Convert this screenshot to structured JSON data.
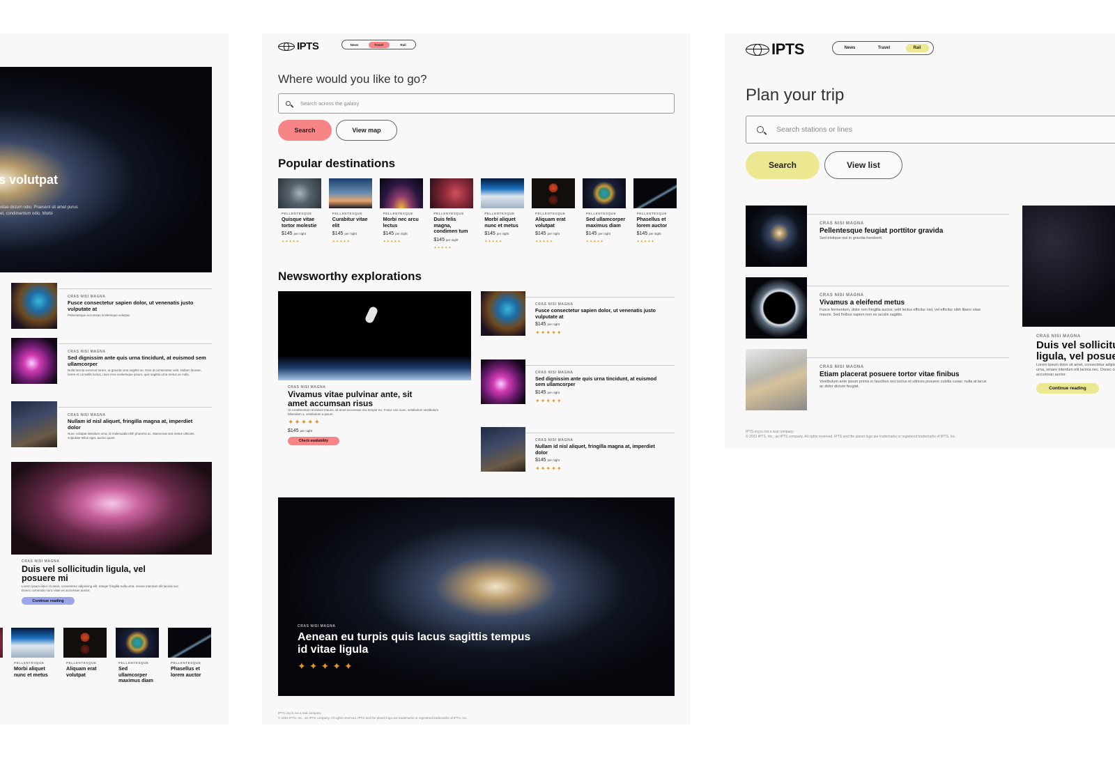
{
  "brand": {
    "name": "IPTS"
  },
  "left_panel": {
    "hero": {
      "title_fragment": "s volutpat",
      "body": "vitae dictum odio. Praesent sit amet purus et, condimentum odio. Morbi"
    },
    "news": [
      {
        "kicker": "CRAS NISI MAGNA",
        "title": "Fusce consectetur sapien dolor, ut venenatis justo vulputate at",
        "body": "Pellentesque accumsan scelerisque volutpat."
      },
      {
        "kicker": "CRAS NISI MAGNA",
        "title": "Sed dignissim ante quis urna tincidunt, at euismod sem ullamcorper",
        "body": "Nulla lacinia euismod lorem, at gravida urna sagittis ac. Duis at consectetur velit. Nullam laoreet, lorem et convallis luctus, risus eros scelerisque ipsum, quis sagittis urna metus ac nulla."
      },
      {
        "kicker": "CRAS NISI MAGNA",
        "title": "Nullam id nisl aliquet, fringilla magna at, imperdiet dolor",
        "body": "Nunc volutpat interdum urna, id malesuada nibh pharetra ac. Maecenas sed metus ultricies, vulputate tellus eget, auctor quam."
      }
    ],
    "feature": {
      "kicker": "CRAS NISI MAGNA",
      "title": "Duis vel sollicitudin ligula, vel posuere mi",
      "body": "Lorem ipsum dolor sit amet, consectetur adipiscing elit. Integer fringilla nulla urna, ornare interdum elit lacinia nec. Donec commodo nunc vitae ex accumsan auctor.",
      "button": "Continue reading",
      "accent": "#9aa6e8"
    },
    "destinations": [
      {
        "kicker": "PELLENTESQUE",
        "title": "Morbi aliquet nunc et metus"
      },
      {
        "kicker": "PELLENTESQUE",
        "title": "Aliquam erat volutpat"
      },
      {
        "kicker": "PELLENTESQUE",
        "title": "Sed ullamcorper maximus diam"
      },
      {
        "kicker": "PELLENTESQUE",
        "title": "Phasellus et lorem auctor"
      }
    ]
  },
  "mid_panel": {
    "nav": {
      "items": [
        "News",
        "Travel",
        "Rail"
      ],
      "active": "Travel"
    },
    "accent": "#f78587",
    "heading": "Where would you like to go?",
    "search": {
      "placeholder": "Search across the galaxy"
    },
    "buttons": {
      "primary": "Search",
      "secondary": "View map"
    },
    "popular": {
      "title": "Popular destinations",
      "items": [
        {
          "kicker": "PELLENTESQUE",
          "title": "Quisque vitae tortor molestie",
          "price": "$145",
          "unit": "per night",
          "rating": 5
        },
        {
          "kicker": "PELLENTESQUE",
          "title": "Curabitur vitae elit",
          "price": "$145",
          "unit": "per night",
          "rating": 5
        },
        {
          "kicker": "PELLENTESQUE",
          "title": "Morbi nec arcu lectus",
          "price": "$145",
          "unit": "per night",
          "rating": 5
        },
        {
          "kicker": "PELLENTESQUE",
          "title": "Duis felis magna, condimen tum",
          "price": "$145",
          "unit": "per night",
          "rating": 5
        },
        {
          "kicker": "PELLENTESQUE",
          "title": "Morbi aliquet nunc et metus",
          "price": "$145",
          "unit": "per night",
          "rating": 5
        },
        {
          "kicker": "PELLENTESQUE",
          "title": "Aliquam erat volutpat",
          "price": "$145",
          "unit": "per night",
          "rating": 5
        },
        {
          "kicker": "PELLENTESQUE",
          "title": "Sed ullamcorper maximus diam",
          "price": "$145",
          "unit": "per night",
          "rating": 5
        },
        {
          "kicker": "PELLENTESQUE",
          "title": "Phasellus et lorem auctor",
          "price": "$145",
          "unit": "per night",
          "rating": 5
        }
      ]
    },
    "newsworthy": {
      "title": "Newsworthy explorations",
      "feature": {
        "kicker": "CRAS NISI MAGNA",
        "title": "Vivamus vitae pulvinar ante, sit amet accumsan risus",
        "body": "Ut condimentum tincidunt mauris, sit amet accumsan nisi tempor eu. Fusce orci nunc, vestibulum vestibulum bibendum a, vestibulum a ipsum.",
        "rating": 5,
        "price": "$145",
        "unit": "per night",
        "button": "Check availability"
      },
      "items": [
        {
          "kicker": "CRAS NISI MAGNA",
          "title": "Fusce consectetur sapien dolor, ut venenatis justo vulputate at",
          "price": "$145",
          "unit": "per night",
          "rating": 5
        },
        {
          "kicker": "CRAS NISI MAGNA",
          "title": "Sed dignissim ante quis urna tincidunt, at euismod sem ullamcorper",
          "price": "$145",
          "unit": "per night",
          "rating": 5
        },
        {
          "kicker": "CRAS NISI MAGNA",
          "title": "Nullam id nisl aliquet, fringilla magna at, imperdiet dolor",
          "price": "$145",
          "unit": "per night",
          "rating": 5
        }
      ]
    },
    "hero": {
      "kicker": "CRAS NISI MAGNA",
      "title": "Aenean eu turpis quis lacus sagittis tempus id vitae ligula",
      "rating": 5
    },
    "footer": {
      "line1": "IPTS.org is not a real company.",
      "line2": "© 2023 IPTS, Inc., an IPTS company. All rights reserved. IPTS and the planet logo are trademarks or registered trademarks of IPTS, Inc."
    }
  },
  "right_panel": {
    "nav": {
      "items": [
        "News",
        "Travel",
        "Rail"
      ],
      "active": "Rail"
    },
    "accent": "#ece892",
    "heading": "Plan your trip",
    "search": {
      "placeholder": "Search stations or lines"
    },
    "buttons": {
      "primary": "Search",
      "secondary": "View list"
    },
    "news": [
      {
        "kicker": "CRAS NISI MAGNA",
        "title": "Pellentesque feugiat porttitor gravida",
        "body": "Sed tristique nisl in gravida hendrerit."
      },
      {
        "kicker": "CRAS NISI MAGNA",
        "title": "Vivamus a eleifend metus",
        "body": "Fusce fermentum, dolor non fringilla auctor, velit lectus efficitur nisl, vel efficitur nibh libero vitae mauris. Sed finibus sapien non ex iaculis sagittis."
      },
      {
        "kicker": "CRAS NISI MAGNA",
        "title": "Etiam placerat posuere tortor vitae finibus",
        "body": "Vestibulum ante ipsum primis in faucibus orci luctus et ultrices posuere cubilia curae; nulla at lacus ac dolor dictum feugiat."
      }
    ],
    "feature": {
      "kicker": "CRAS NISI MAGNA",
      "title": "Duis vel sollicitudin ligula, vel posuere mi",
      "body": "Lorem ipsum dolor sit amet, consectetur adipiscing elit. Integer fringilla nulla urna, ornare interdum elit lacinia nec. Donec commodo nunc vitae ex accumsan auctor.",
      "button": "Continue reading"
    },
    "footer": {
      "line1": "IPTS.org is not a real company.",
      "line2": "© 2023 IPTS, Inc., an IPTS company. All rights reserved. IPTS and the planet logo are trademarks or registered trademarks of IPTS, Inc."
    }
  }
}
